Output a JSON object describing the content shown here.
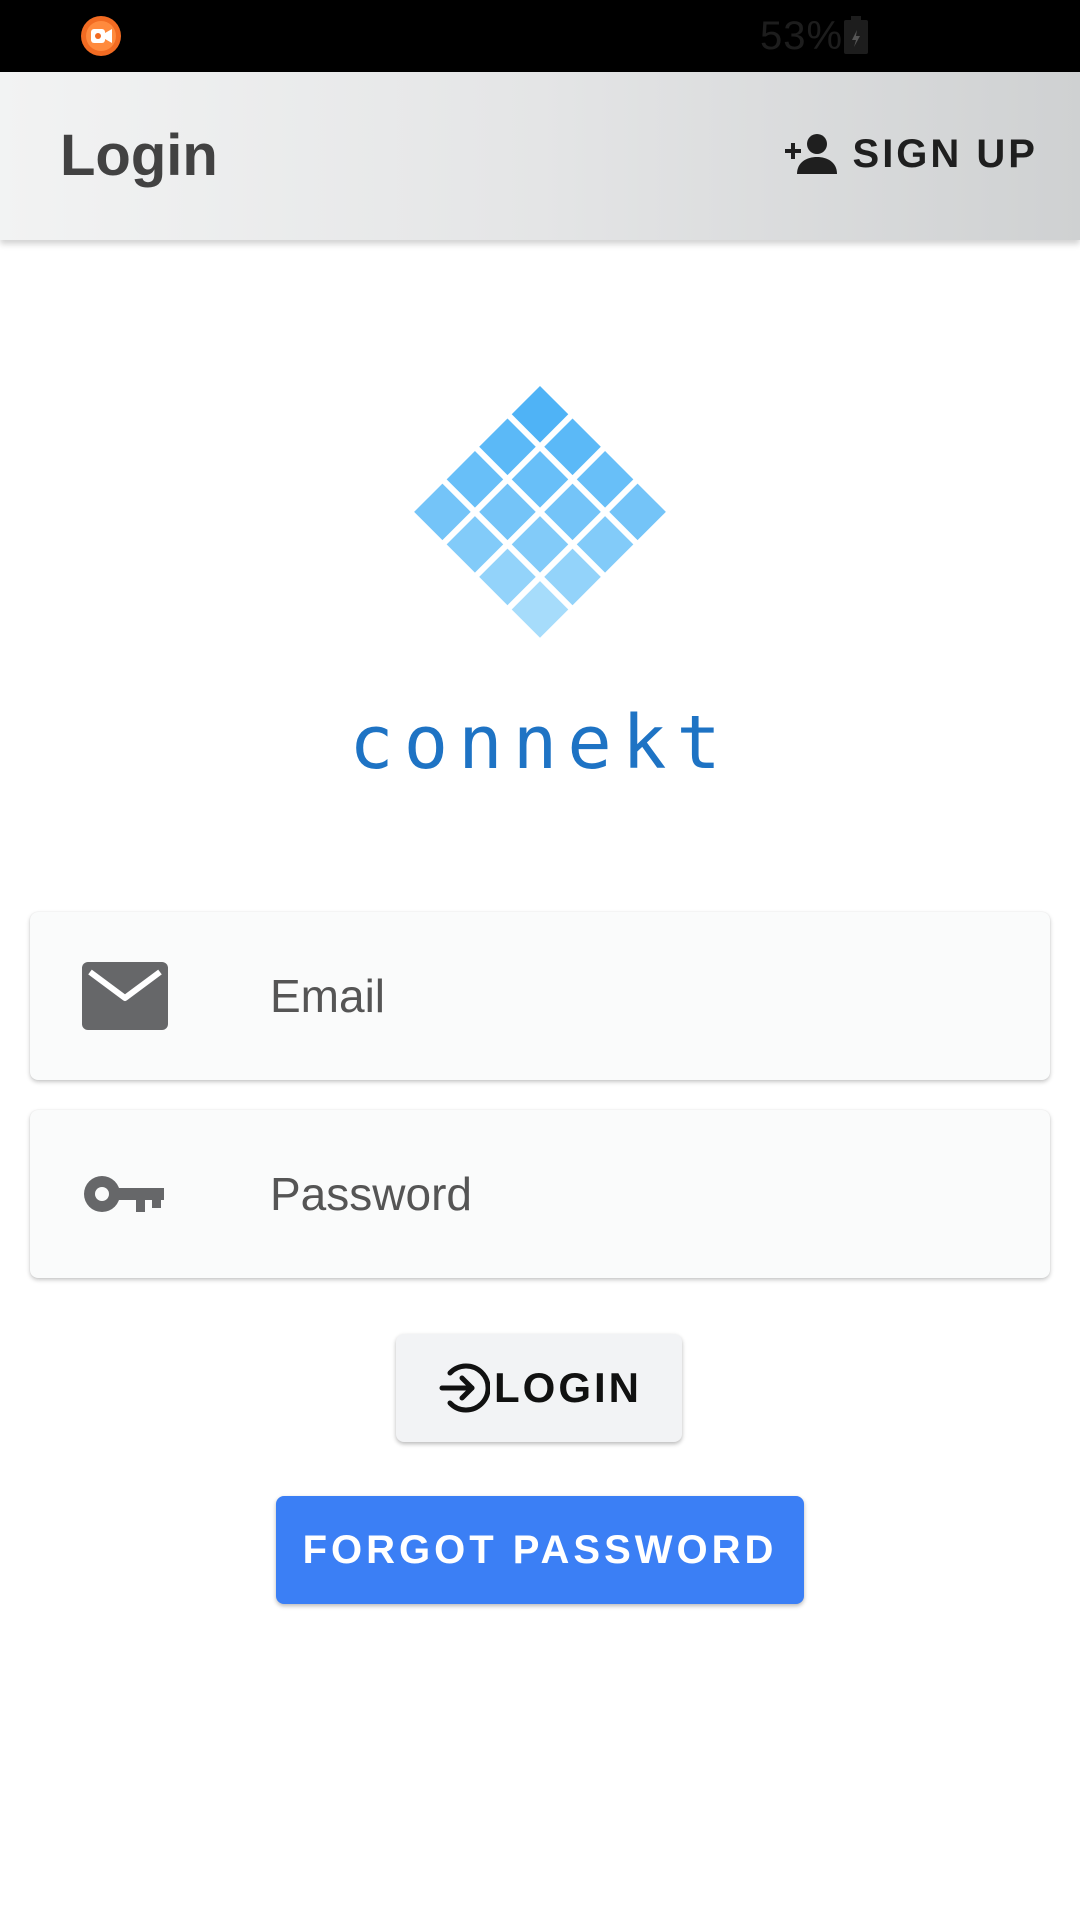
{
  "status_bar": {
    "battery_percent": "53%",
    "recorder_icon": "screen-recorder-icon",
    "battery_icon": "battery-charging-icon"
  },
  "app_bar": {
    "title": "Login",
    "signup_label": "SIGN UP",
    "signup_icon": "person-add-icon"
  },
  "logo": {
    "brand_name": "connekt",
    "mark_icon": "diamond-grid-logo",
    "color": "#1e73c4"
  },
  "form": {
    "email": {
      "placeholder": "Email",
      "value": "",
      "icon": "envelope-icon"
    },
    "password": {
      "placeholder": "Password",
      "value": "",
      "icon": "key-icon"
    }
  },
  "actions": {
    "login_label": "LOGIN",
    "login_icon": "login-arrow-icon",
    "forgot_label": "FORGOT PASSWORD",
    "forgot_color": "#3b7ff5"
  }
}
